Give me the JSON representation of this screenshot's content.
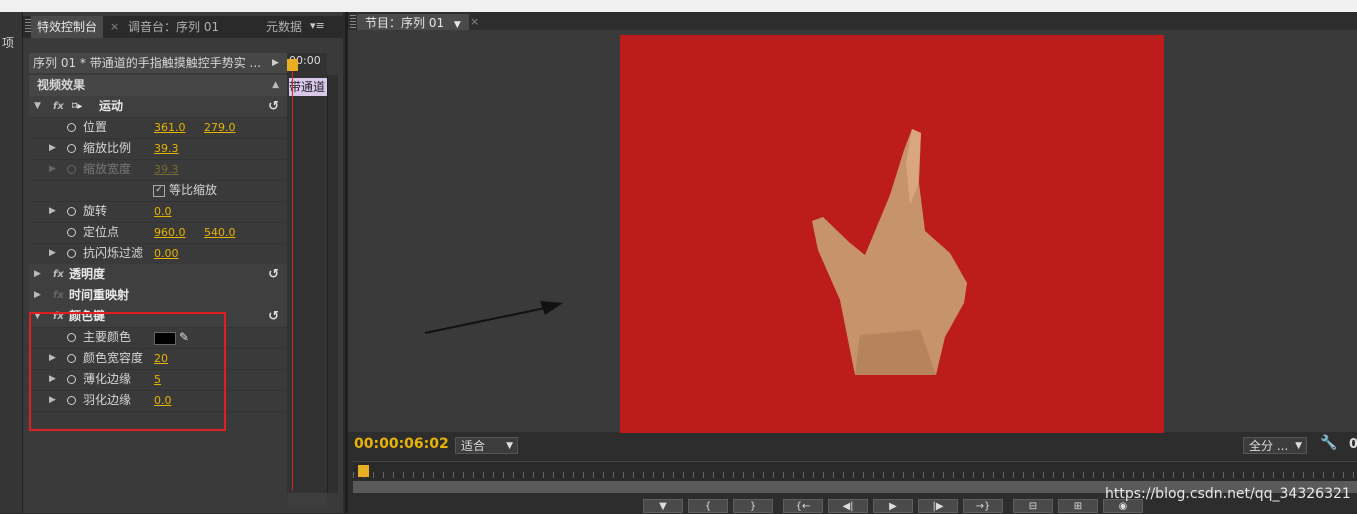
{
  "left_strip": {
    "label": "项"
  },
  "tabs": {
    "effect_controls": "特效控制台",
    "audio_mixer": "调音台：序列 01",
    "metadata": "元数据",
    "menu_symbol": "▾≡"
  },
  "sequence_header": {
    "title": "序列 01 * 带通道的手指触摸触控手势实 ...",
    "timecode": "00:00",
    "clip_label": "带通道"
  },
  "effects": {
    "section_title": "视频效果",
    "motion": {
      "name": "运动",
      "position": {
        "label": "位置",
        "x": "361.0",
        "y": "279.0"
      },
      "scale": {
        "label": "缩放比例",
        "value": "39.3"
      },
      "scale_width": {
        "label": "缩放宽度",
        "value": "39.3"
      },
      "uniform_scale": {
        "label": "等比缩放",
        "checked": true
      },
      "rotation": {
        "label": "旋转",
        "value": "0.0"
      },
      "anchor": {
        "label": "定位点",
        "x": "960.0",
        "y": "540.0"
      },
      "anti_flicker": {
        "label": "抗闪烁过滤",
        "value": "0.00"
      }
    },
    "opacity": {
      "name": "透明度"
    },
    "time_remap": {
      "name": "时间重映射"
    },
    "color_key": {
      "name": "颜色键",
      "key_color": {
        "label": "主要颜色",
        "color": "#000000"
      },
      "tolerance": {
        "label": "颜色宽容度",
        "value": "20"
      },
      "thin_edge": {
        "label": "薄化边缘",
        "value": "5"
      },
      "feather": {
        "label": "羽化边缘",
        "value": "0.0"
      }
    }
  },
  "program_monitor": {
    "tab_label": "节目：序列 01",
    "timecode": "00:00:06:02",
    "fit_option": "适合",
    "resolution_option": "全分 ...",
    "right_value": "0",
    "frame_color": "#bd1c1c"
  },
  "watermark": "https://blog.csdn.net/qq_34326321"
}
